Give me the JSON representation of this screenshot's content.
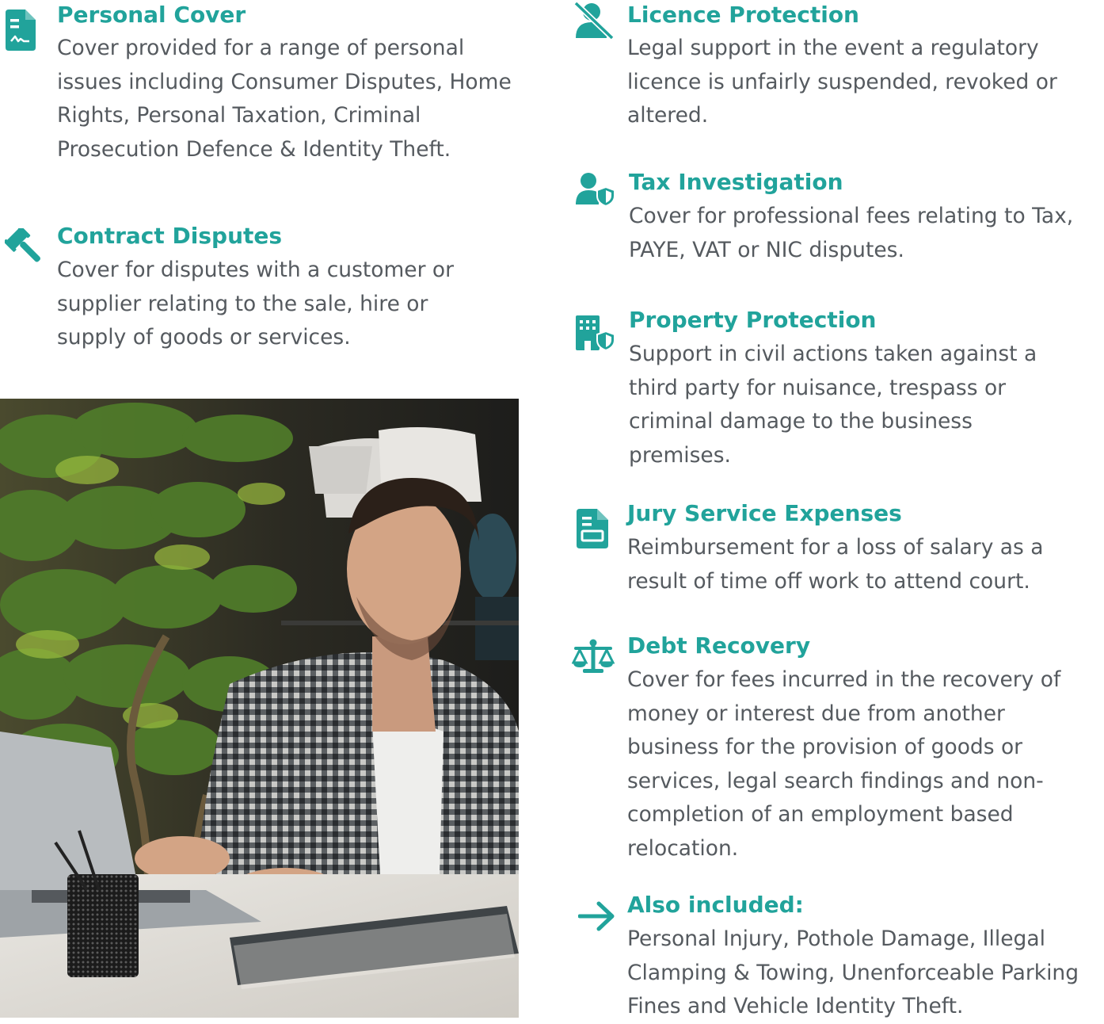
{
  "accent_color": "#21a39b",
  "text_color": "#555a5f",
  "left_items": [
    {
      "icon": "medical-document-icon",
      "title": "Personal Cover",
      "description": "Cover provided for a range of personal issues including Consumer Disputes, Home Rights, Personal Taxation, Criminal Prosecution Defence & Identity Theft."
    },
    {
      "icon": "gavel-icon",
      "title": "Contract Disputes",
      "description": "Cover for disputes with a customer or supplier relating to the sale, hire or supply of goods or services."
    }
  ],
  "right_items": [
    {
      "icon": "user-slash-icon",
      "title": "Licence Protection",
      "description": "Legal support in the event a regulatory licence is unfairly suspended, revoked or altered."
    },
    {
      "icon": "user-shield-icon",
      "title": "Tax Investigation",
      "description": "Cover for professional fees relating to Tax, PAYE, VAT or NIC disputes."
    },
    {
      "icon": "building-shield-icon",
      "title": "Property Protection",
      "description": "Support in civil actions taken against a third party for nuisance, trespass or criminal damage to the business premises."
    },
    {
      "icon": "document-icon",
      "title": "Jury Service Expenses",
      "description": "Reimbursement for a loss of salary as a result of time off work to attend court."
    },
    {
      "icon": "scales-icon",
      "title": "Debt Recovery",
      "description": "Cover for fees incurred in the recovery of money or interest due from another business for the provision of goods or services, legal search findings and non-completion of an employment based relocation."
    },
    {
      "icon": "arrow-right-icon",
      "title": "Also included:",
      "description": "Personal Injury, Pothole Damage, Illegal Clamping & Towing, Unenforceable Parking Fines and Vehicle Identity Theft."
    }
  ]
}
